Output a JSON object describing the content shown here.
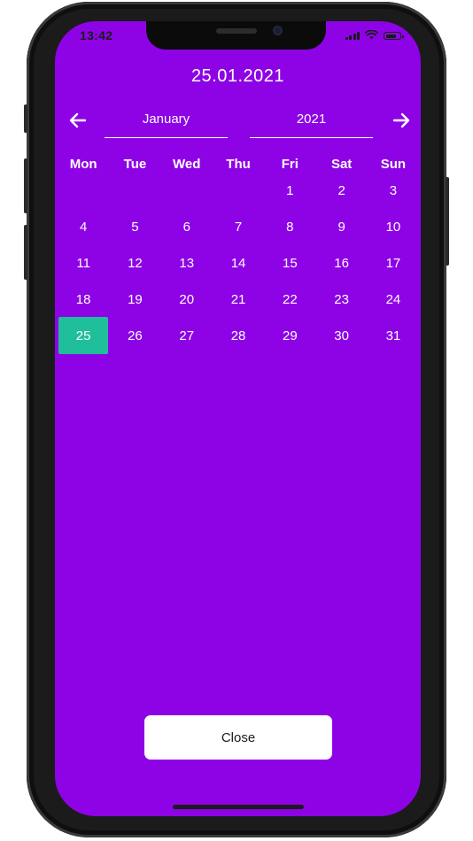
{
  "status_bar": {
    "time": "13:42",
    "icons": [
      "signal-icon",
      "wifi-icon",
      "battery-icon"
    ]
  },
  "header": {
    "selected_date": "25.01.2021"
  },
  "controls": {
    "prev_icon": "arrow-left-icon",
    "next_icon": "arrow-right-icon",
    "month": "January",
    "year": "2021"
  },
  "calendar": {
    "weekdays": [
      "Mon",
      "Tue",
      "Wed",
      "Thu",
      "Fri",
      "Sat",
      "Sun"
    ],
    "weeks": [
      [
        "",
        "",
        "",
        "",
        "1",
        "2",
        "3"
      ],
      [
        "4",
        "5",
        "6",
        "7",
        "8",
        "9",
        "10"
      ],
      [
        "11",
        "12",
        "13",
        "14",
        "15",
        "16",
        "17"
      ],
      [
        "18",
        "19",
        "20",
        "21",
        "22",
        "23",
        "24"
      ],
      [
        "25",
        "26",
        "27",
        "28",
        "29",
        "30",
        "31"
      ]
    ],
    "selected_day": "25"
  },
  "footer": {
    "close_label": "Close"
  },
  "colors": {
    "background": "#8e03e6",
    "selected": "#1ebf9a",
    "text": "#ffffff",
    "button_bg": "#ffffff"
  }
}
